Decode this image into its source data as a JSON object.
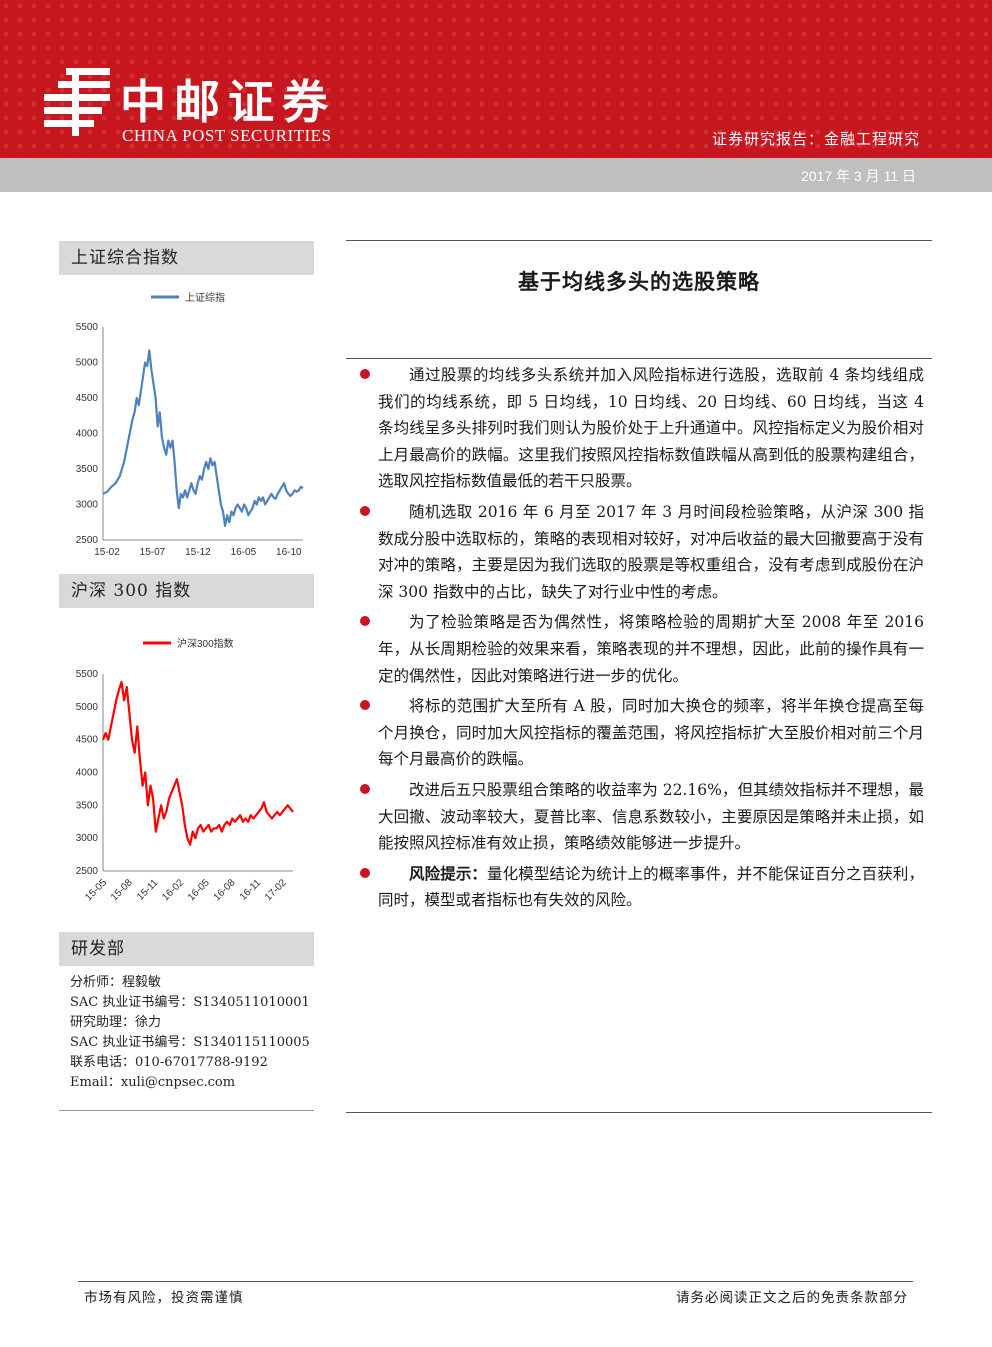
{
  "header": {
    "logo_cn": "中邮证券",
    "logo_en": "CHINA POST SECURITIES",
    "report_type": "证券研究报告：金融工程研究",
    "date": "2017 年 3 月 11 日",
    "brand_color": "#c8161e"
  },
  "sidebar": {
    "chart1_title": "上证综合指数",
    "chart2_title": "沪深 300 指数",
    "dept_title": "研发部",
    "analyst_lines": [
      "分析师：程毅敏",
      "SAC 执业证书编号：S1340511010001",
      "研究助理：徐力",
      "SAC 执业证书编号：S1340115110005",
      "联系电话：010-67017788-9192",
      "Email：xuli@cnpsec.com"
    ]
  },
  "main": {
    "title": "基于均线多头的选股策略",
    "paragraphs": [
      {
        "bold": "",
        "text": "通过股票的均线多头系统并加入风险指标进行选股，选取前 4 条均线组成我们的均线系统，即 5 日均线，10 日均线、20 日均线、60 日均线，当这 4 条均线呈多头排列时我们则认为股价处于上升通道中。风控指标定义为股价相对上月最高价的跌幅。这里我们按照风控指标数值跌幅从高到低的股票构建组合，选取风控指标数值最低的若干只股票。"
      },
      {
        "bold": "",
        "text": "随机选取 2016 年 6 月至 2017 年 3 月时间段检验策略，从沪深 300 指数成分股中选取标的，策略的表现相对较好，对冲后收益的最大回撤要高于没有对冲的策略，主要是因为我们选取的股票是等权重组合，没有考虑到成股份在沪深 300 指数中的占比，缺失了对行业中性的考虑。"
      },
      {
        "bold": "",
        "text": "为了检验策略是否为偶然性，将策略检验的周期扩大至 2008 年至 2016 年，从长周期检验的效果来看，策略表现的并不理想，因此，此前的操作具有一定的偶然性，因此对策略进行进一步的优化。"
      },
      {
        "bold": "",
        "text": "将标的范围扩大至所有 A 股，同时加大换仓的频率，将半年换仓提高至每个月换仓，同时加大风控指标的覆盖范围，将风控指标扩大至股价相对前三个月每个月最高价的跌幅。"
      },
      {
        "bold": "",
        "text": "改进后五只股票组合策略的收益率为 22.16%，但其绩效指标并不理想，最大回撤、波动率较大，夏普比率、信息系数较小，主要原因是策略并未止损，如能按照风控标准有效止损，策略绩效能够进一步提升。"
      },
      {
        "bold": "风险提示：",
        "text": "量化模型结论为统计上的概率事件，并不能保证百分之百获利，同时，模型或者指标也有失效的风险。"
      }
    ]
  },
  "footer": {
    "left": "市场有风险，投资需谨慎",
    "right": "请务必阅读正文之后的免责条款部分"
  },
  "chart_data": [
    {
      "type": "line",
      "series": [
        {
          "name": "上证综指",
          "color": "#4f81bd",
          "points": [
            [
              0,
              3150
            ],
            [
              2,
              3180
            ],
            [
              4,
              3250
            ],
            [
              6,
              3300
            ],
            [
              8,
              3400
            ],
            [
              10,
              3600
            ],
            [
              11,
              3750
            ],
            [
              12,
              3900
            ],
            [
              13,
              4050
            ],
            [
              14,
              4200
            ],
            [
              15,
              4300
            ],
            [
              16,
              4500
            ],
            [
              17,
              4400
            ],
            [
              18,
              4600
            ],
            [
              19,
              4800
            ],
            [
              20,
              5000
            ],
            [
              21,
              4950
            ],
            [
              22,
              5170
            ],
            [
              23,
              4900
            ],
            [
              24,
              4700
            ],
            [
              25,
              4500
            ],
            [
              26,
              4100
            ],
            [
              27,
              4300
            ],
            [
              28,
              3950
            ],
            [
              29,
              3800
            ],
            [
              30,
              3700
            ],
            [
              31,
              3900
            ],
            [
              32,
              3800
            ],
            [
              33,
              3900
            ],
            [
              34,
              3600
            ],
            [
              35,
              3200
            ],
            [
              36,
              2950
            ],
            [
              37,
              3150
            ],
            [
              38,
              3100
            ],
            [
              39,
              3200
            ],
            [
              40,
              3100
            ],
            [
              41,
              3200
            ],
            [
              42,
              3300
            ],
            [
              43,
              3200
            ],
            [
              44,
              3150
            ],
            [
              45,
              3300
            ],
            [
              46,
              3400
            ],
            [
              47,
              3350
            ],
            [
              48,
              3500
            ],
            [
              49,
              3600
            ],
            [
              50,
              3500
            ],
            [
              51,
              3650
            ],
            [
              52,
              3550
            ],
            [
              53,
              3600
            ],
            [
              54,
              3400
            ],
            [
              55,
              3200
            ],
            [
              56,
              3000
            ],
            [
              57,
              2900
            ],
            [
              58,
              2700
            ],
            [
              59,
              2850
            ],
            [
              60,
              2750
            ],
            [
              61,
              2900
            ],
            [
              62,
              2850
            ],
            [
              63,
              2950
            ],
            [
              64,
              3000
            ],
            [
              65,
              2950
            ],
            [
              66,
              2900
            ],
            [
              67,
              3000
            ],
            [
              68,
              2950
            ],
            [
              69,
              2850
            ],
            [
              70,
              2900
            ],
            [
              71,
              2950
            ],
            [
              72,
              3050
            ],
            [
              73,
              3000
            ],
            [
              74,
              3100
            ],
            [
              75,
              3050
            ],
            [
              76,
              3100
            ],
            [
              77,
              3000
            ],
            [
              78,
              3050
            ],
            [
              79,
              3100
            ],
            [
              80,
              3150
            ],
            [
              81,
              3100
            ],
            [
              82,
              3080
            ],
            [
              83,
              3150
            ],
            [
              84,
              3200
            ],
            [
              85,
              3250
            ],
            [
              86,
              3300
            ],
            [
              87,
              3200
            ],
            [
              88,
              3150
            ],
            [
              89,
              3120
            ],
            [
              90,
              3150
            ],
            [
              91,
              3200
            ],
            [
              92,
              3180
            ],
            [
              93,
              3200
            ],
            [
              94,
              3250
            ],
            [
              95,
              3230
            ]
          ]
        }
      ],
      "categories": [
        "15-02",
        "15-07",
        "15-12",
        "16-05",
        "16-10"
      ],
      "ylim": [
        2500,
        5500
      ],
      "yticks": [
        "2500",
        "3000",
        "3500",
        "4000",
        "4500",
        "5000",
        "5500"
      ]
    },
    {
      "type": "line",
      "series": [
        {
          "name": "沪深300指数",
          "color": "#ff0000",
          "points": [
            [
              0,
              4500
            ],
            [
              1,
              4600
            ],
            [
              2,
              4500
            ],
            [
              3,
              4700
            ],
            [
              4,
              4900
            ],
            [
              5,
              5100
            ],
            [
              6,
              5250
            ],
            [
              7,
              5380
            ],
            [
              8,
              5100
            ],
            [
              9,
              5300
            ],
            [
              10,
              4900
            ],
            [
              11,
              4500
            ],
            [
              12,
              4300
            ],
            [
              13,
              4700
            ],
            [
              14,
              4200
            ],
            [
              15,
              3800
            ],
            [
              16,
              4000
            ],
            [
              17,
              3500
            ],
            [
              18,
              3800
            ],
            [
              19,
              3600
            ],
            [
              20,
              3100
            ],
            [
              21,
              3300
            ],
            [
              22,
              3500
            ],
            [
              23,
              3300
            ],
            [
              24,
              3400
            ],
            [
              25,
              3600
            ],
            [
              26,
              3700
            ],
            [
              27,
              3800
            ],
            [
              28,
              3900
            ],
            [
              29,
              3700
            ],
            [
              30,
              3500
            ],
            [
              31,
              3200
            ],
            [
              32,
              3000
            ],
            [
              33,
              2900
            ],
            [
              34,
              3100
            ],
            [
              35,
              3000
            ],
            [
              36,
              3150
            ],
            [
              37,
              3200
            ],
            [
              38,
              3100
            ],
            [
              39,
              3150
            ],
            [
              40,
              3200
            ],
            [
              41,
              3100
            ],
            [
              42,
              3150
            ],
            [
              43,
              3150
            ],
            [
              44,
              3200
            ],
            [
              45,
              3100
            ],
            [
              46,
              3200
            ],
            [
              47,
              3250
            ],
            [
              48,
              3200
            ],
            [
              49,
              3300
            ],
            [
              50,
              3250
            ],
            [
              51,
              3300
            ],
            [
              52,
              3350
            ],
            [
              53,
              3250
            ],
            [
              54,
              3300
            ],
            [
              55,
              3250
            ],
            [
              56,
              3350
            ],
            [
              57,
              3300
            ],
            [
              58,
              3350
            ],
            [
              59,
              3400
            ],
            [
              60,
              3450
            ],
            [
              61,
              3550
            ],
            [
              62,
              3400
            ],
            [
              63,
              3350
            ],
            [
              64,
              3300
            ],
            [
              65,
              3350
            ],
            [
              66,
              3400
            ],
            [
              67,
              3350
            ],
            [
              68,
              3400
            ],
            [
              69,
              3450
            ],
            [
              70,
              3500
            ],
            [
              71,
              3450
            ],
            [
              72,
              3400
            ]
          ]
        }
      ],
      "categories": [
        "15-05",
        "15-08",
        "15-11",
        "16-02",
        "16-05",
        "16-08",
        "16-11",
        "17-02"
      ],
      "ylim": [
        2500,
        5500
      ],
      "yticks": [
        "2500",
        "3000",
        "3500",
        "4000",
        "4500",
        "5000",
        "5500"
      ]
    }
  ]
}
